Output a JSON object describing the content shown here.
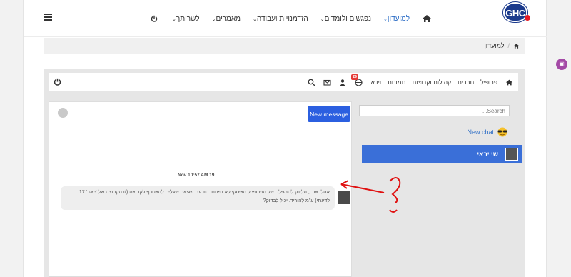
{
  "logo": {
    "text": "GHC"
  },
  "nav": {
    "items": [
      {
        "label": "למועדון",
        "active": true
      },
      {
        "label": "נפגשים ולומדים",
        "active": false
      },
      {
        "label": "הזדמנויות ועבודה",
        "active": false
      },
      {
        "label": "מאמרים",
        "active": false
      },
      {
        "label": "לשרותך",
        "active": false
      }
    ]
  },
  "breadcrumb": {
    "current": "למועדון"
  },
  "subnav": {
    "items": [
      "פרופיל",
      "חברים",
      "קהילות וקבוצות",
      "תמונות",
      "וידאו"
    ],
    "badge_count": "29"
  },
  "sidebar": {
    "search_placeholder": "Search...",
    "new_chat_label": "New chat",
    "thread_name": "שי יבאי"
  },
  "conversation": {
    "new_message_label": "New message",
    "timestamp": "Nov 10:57 AM 19",
    "message_text": "אהלן אודי, הלינק לטמפלט של הפרופייל הציסקי לא נפתח. הודעת שגיאה שעלים להצטרף לקבוצה (זו הקבוצה של 'יואב' 17 לדעתי) ע\"מ להוריד. יכול לבדוק?"
  },
  "colors": {
    "accent": "#2b5fe0",
    "thread_bg": "#3a6fd8",
    "annotation": "#e01010"
  }
}
